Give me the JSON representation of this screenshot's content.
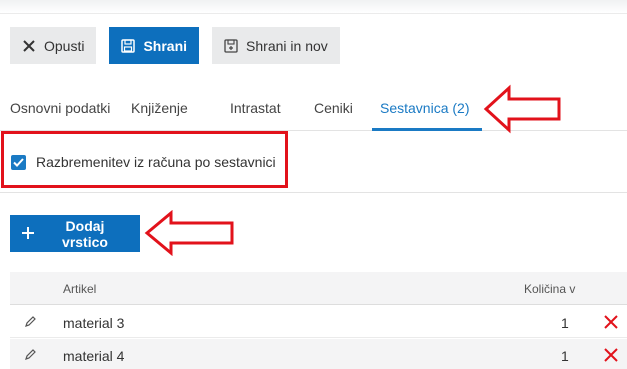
{
  "toolbar": {
    "cancel_label": "Opusti",
    "save_label": "Shrani",
    "save_new_label": "Shrani in nov"
  },
  "tabs": [
    {
      "label": "Osnovni podatki",
      "active": false
    },
    {
      "label": "Knjiženje",
      "active": false
    },
    {
      "label": "Intrastat",
      "active": false
    },
    {
      "label": "Ceniki",
      "active": false
    },
    {
      "label": "Sestavnica (2)",
      "active": true
    }
  ],
  "checkbox": {
    "label": "Razbremenitev iz računa po sestavnici",
    "checked": true
  },
  "add_row_label": "Dodaj vrstico",
  "table": {
    "columns": [
      "Artikel",
      "Količina v"
    ],
    "rows": [
      {
        "article": "material 3",
        "quantity": "1"
      },
      {
        "article": "material 4",
        "quantity": "1"
      }
    ]
  },
  "colors": {
    "primary": "#0d6fbd",
    "tab_active": "#1a7ac4",
    "annotation": "#e2121b",
    "delete": "#e2121b"
  },
  "icons": [
    "close-icon",
    "save-icon",
    "save-new-icon",
    "plus-icon",
    "pencil-icon",
    "delete-icon",
    "checkmark-icon",
    "arrow-left-icon"
  ]
}
